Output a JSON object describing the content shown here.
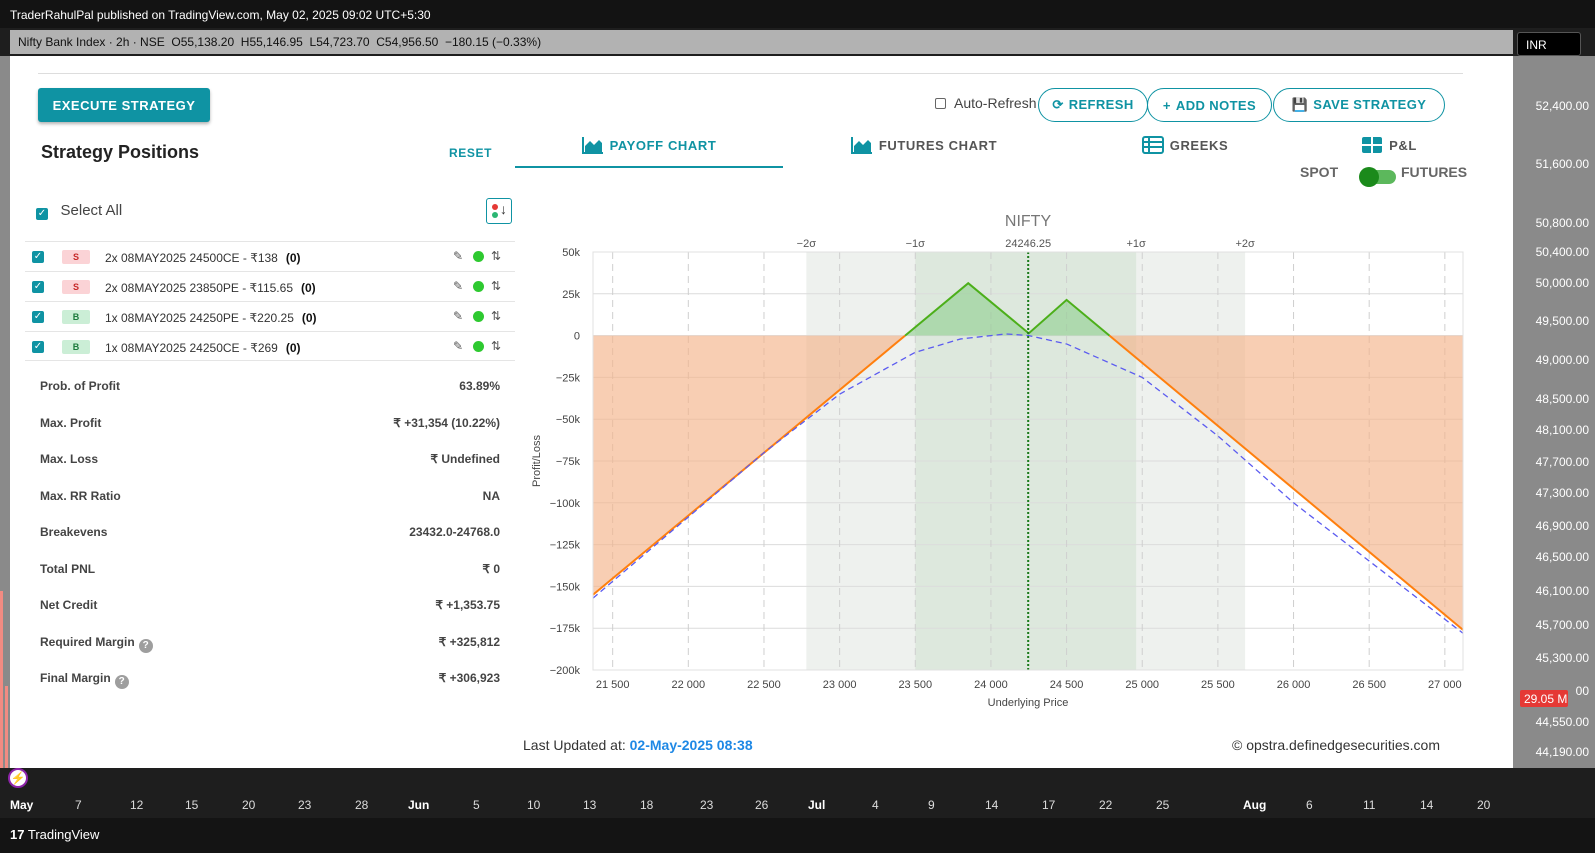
{
  "publisher": "TraderRahulPal published on TradingView.com, May 02, 2025 09:02 UTC+5:30",
  "symbol_header": "Nifty Bank Index · 2h · NSE",
  "ohlc": {
    "o": "O55,138.20",
    "h": "H55,146.95",
    "l": "L54,723.70",
    "c": "C54,956.50",
    "chg": "−180.15 (−0.33%)"
  },
  "currency": "INR",
  "price_axis": [
    "52,400.00",
    "51,600.00",
    "50,800.00",
    "50,400.00",
    "50,000.00",
    "49,500.00",
    "49,000.00",
    "48,500.00",
    "48,100.00",
    "47,700.00",
    "47,300.00",
    "46,900.00",
    "46,500.00",
    "46,100.00",
    "45,700.00",
    "45,300.00",
    "00",
    "44,550.00",
    "44,190.00"
  ],
  "volume_badge": "29.05 M",
  "time_axis": [
    "May",
    "7",
    "12",
    "15",
    "20",
    "23",
    "28",
    "Jun",
    "5",
    "10",
    "13",
    "18",
    "23",
    "26",
    "Jul",
    "4",
    "9",
    "14",
    "17",
    "22",
    "25",
    "Aug",
    "6",
    "11",
    "14",
    "20"
  ],
  "brand": "TradingView",
  "toolbar": {
    "execute": "EXECUTE STRATEGY",
    "auto_refresh": "Auto-Refresh",
    "refresh": "REFRESH",
    "add_notes": "ADD NOTES",
    "save_strategy": "SAVE STRATEGY"
  },
  "positions_panel": {
    "title": "Strategy Positions",
    "reset": "RESET",
    "select_all": "Select All",
    "rows": [
      {
        "side": "S",
        "text": "2x  08MAY2025 24500CE  - ₹138",
        "qty": "(0)"
      },
      {
        "side": "S",
        "text": "2x  08MAY2025 23850PE  - ₹115.65",
        "qty": "(0)"
      },
      {
        "side": "B",
        "text": "1x  08MAY2025 24250PE  - ₹220.25",
        "qty": "(0)"
      },
      {
        "side": "B",
        "text": "1x  08MAY2025 24250CE  - ₹269",
        "qty": "(0)"
      }
    ]
  },
  "stats": [
    {
      "k": "Prob. of Profit",
      "v": "63.89%"
    },
    {
      "k": "Max. Profit",
      "v": "₹ +31,354 (10.22%)"
    },
    {
      "k": "Max. Loss",
      "v": "₹ Undefined"
    },
    {
      "k": "Max. RR Ratio",
      "v": "NA"
    },
    {
      "k": "Breakevens",
      "v": "23432.0-24768.0"
    },
    {
      "k": "Total PNL",
      "v": "₹ 0"
    },
    {
      "k": "Net Credit",
      "v": "₹ +1,353.75"
    },
    {
      "k": "Required Margin",
      "v": "₹ +325,812",
      "help": "?"
    },
    {
      "k": "Final Margin",
      "v": "₹ +306,923",
      "help": "?"
    }
  ],
  "tabs": [
    "PAYOFF CHART",
    "FUTURES CHART",
    "GREEKS",
    "P&L"
  ],
  "spot_label": "SPOT",
  "futures_label": "FUTURES",
  "last_updated_label": "Last Updated at:",
  "last_updated": "02-May-2025 08:38",
  "credit": "© opstra.definedgesecurities.com",
  "colors": {
    "accent": "#0f93a3",
    "profit": "#8fce8f",
    "loss": "#f5b48a",
    "payoff": "#ff7f0e",
    "t0": "#5b5bf0"
  },
  "chart_data": {
    "type": "line",
    "title": "NIFTY",
    "xlabel": "Underlying Price",
    "ylabel": "Profit/Loss",
    "xlim": [
      21370,
      27120
    ],
    "ylim": [
      -200000,
      50000
    ],
    "x_ticks": [
      21500,
      22000,
      22500,
      23000,
      23500,
      24000,
      24500,
      25000,
      25500,
      26000,
      26500,
      27000
    ],
    "x_tick_labels": [
      "21 500",
      "22 000",
      "22 500",
      "23 000",
      "23 500",
      "24 000",
      "24 500",
      "25 000",
      "25 500",
      "26 000",
      "26 500",
      "27 000"
    ],
    "y_ticks": [
      50000,
      25000,
      0,
      -25000,
      -50000,
      -75000,
      -100000,
      -125000,
      -150000,
      -175000,
      -200000
    ],
    "y_tick_labels": [
      "50k",
      "25k",
      "0",
      "−25k",
      "−50k",
      "−75k",
      "−100k",
      "−125k",
      "−150k",
      "−175k",
      "−200k"
    ],
    "spot": {
      "value": 24246.25,
      "label": "24246.25"
    },
    "sigma_bands": [
      {
        "label": "−2σ",
        "x": 22780
      },
      {
        "label": "−1σ",
        "x": 23500
      },
      {
        "label": "+1σ",
        "x": 24960
      },
      {
        "label": "+2σ",
        "x": 25680
      }
    ],
    "series": [
      {
        "name": "",
        "kind": "expiry",
        "x": [
          21370,
          23850,
          24250,
          24500,
          27120
        ],
        "y": [
          -155000,
          31354,
          1354,
          21354,
          -176000
        ]
      },
      {
        "name": "",
        "kind": "t0",
        "x": [
          21370,
          22500,
          23000,
          23500,
          23800,
          24000,
          24100,
          24250,
          24500,
          25000,
          25500,
          26000,
          27120
        ],
        "y": [
          -157000,
          -70000,
          -35000,
          -10000,
          -2000,
          0,
          1000,
          0,
          -5000,
          -25000,
          -60000,
          -100000,
          -178000
        ]
      }
    ]
  }
}
